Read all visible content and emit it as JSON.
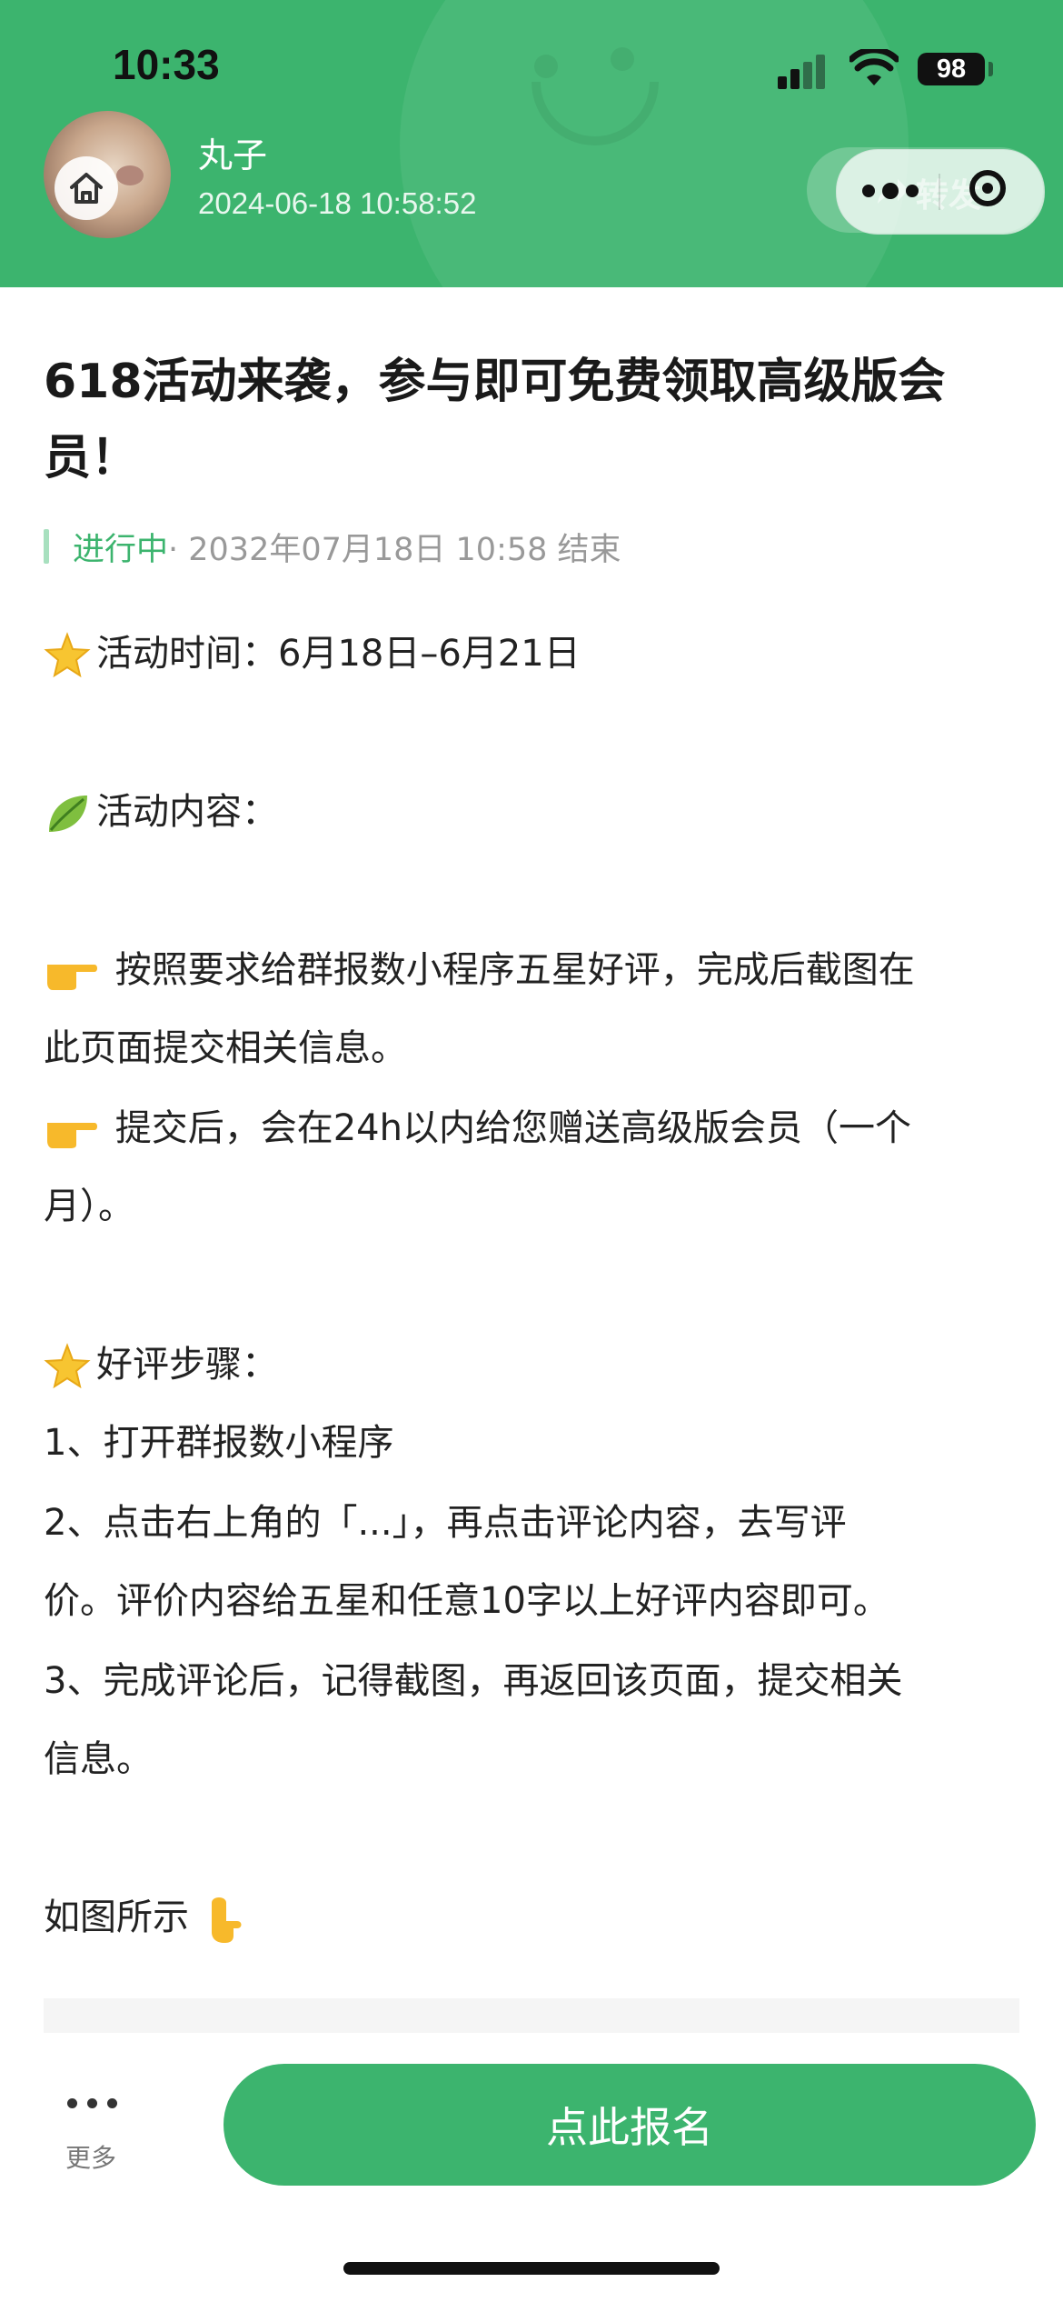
{
  "status_bar": {
    "time": "10:33",
    "battery": "98"
  },
  "header": {
    "user_name": "丸子",
    "post_time": "2024-06-18 10:58:52",
    "share_label": "转发"
  },
  "post": {
    "title": "618活动来袭，参与即可免费领取高级版会员！",
    "status": "进行中",
    "end_info": " · 2032年07月18日 10:58 结束",
    "lines": [
      {
        "emoji": "star",
        "text": "活动时间：6月18日–6月21日"
      },
      {
        "emoji": "leaf",
        "text": "活动内容："
      },
      {
        "emoji": "point-right",
        "text": " 按照要求给群报数小程序五星好评，完成后截图在"
      },
      {
        "emoji": "",
        "text": "此页面提交相关信息。"
      },
      {
        "emoji": "point-right",
        "text": " 提交后，会在24h以内给您赠送高级版会员（一个"
      },
      {
        "emoji": "",
        "text": "月）。"
      },
      {
        "emoji": "star",
        "text": "好评步骤："
      },
      {
        "emoji": "",
        "text": "1、打开群报数小程序"
      },
      {
        "emoji": "",
        "text": "2、点击右上角的「...」，再点击评论内容，去写评"
      },
      {
        "emoji": "",
        "text": "价。评价内容给五星和任意10字以上好评内容即可。"
      },
      {
        "emoji": "",
        "text": "3、完成评论后，记得截图，再返回该页面，提交相关"
      },
      {
        "emoji": "",
        "text": "信息。"
      },
      {
        "emoji": "",
        "text": "如图所示"
      }
    ]
  },
  "bottom_bar": {
    "more_label": "更多",
    "signup_label": "点此报名"
  },
  "colors": {
    "brand_green": "#3cb46e",
    "status_green": "#3cb46e"
  }
}
